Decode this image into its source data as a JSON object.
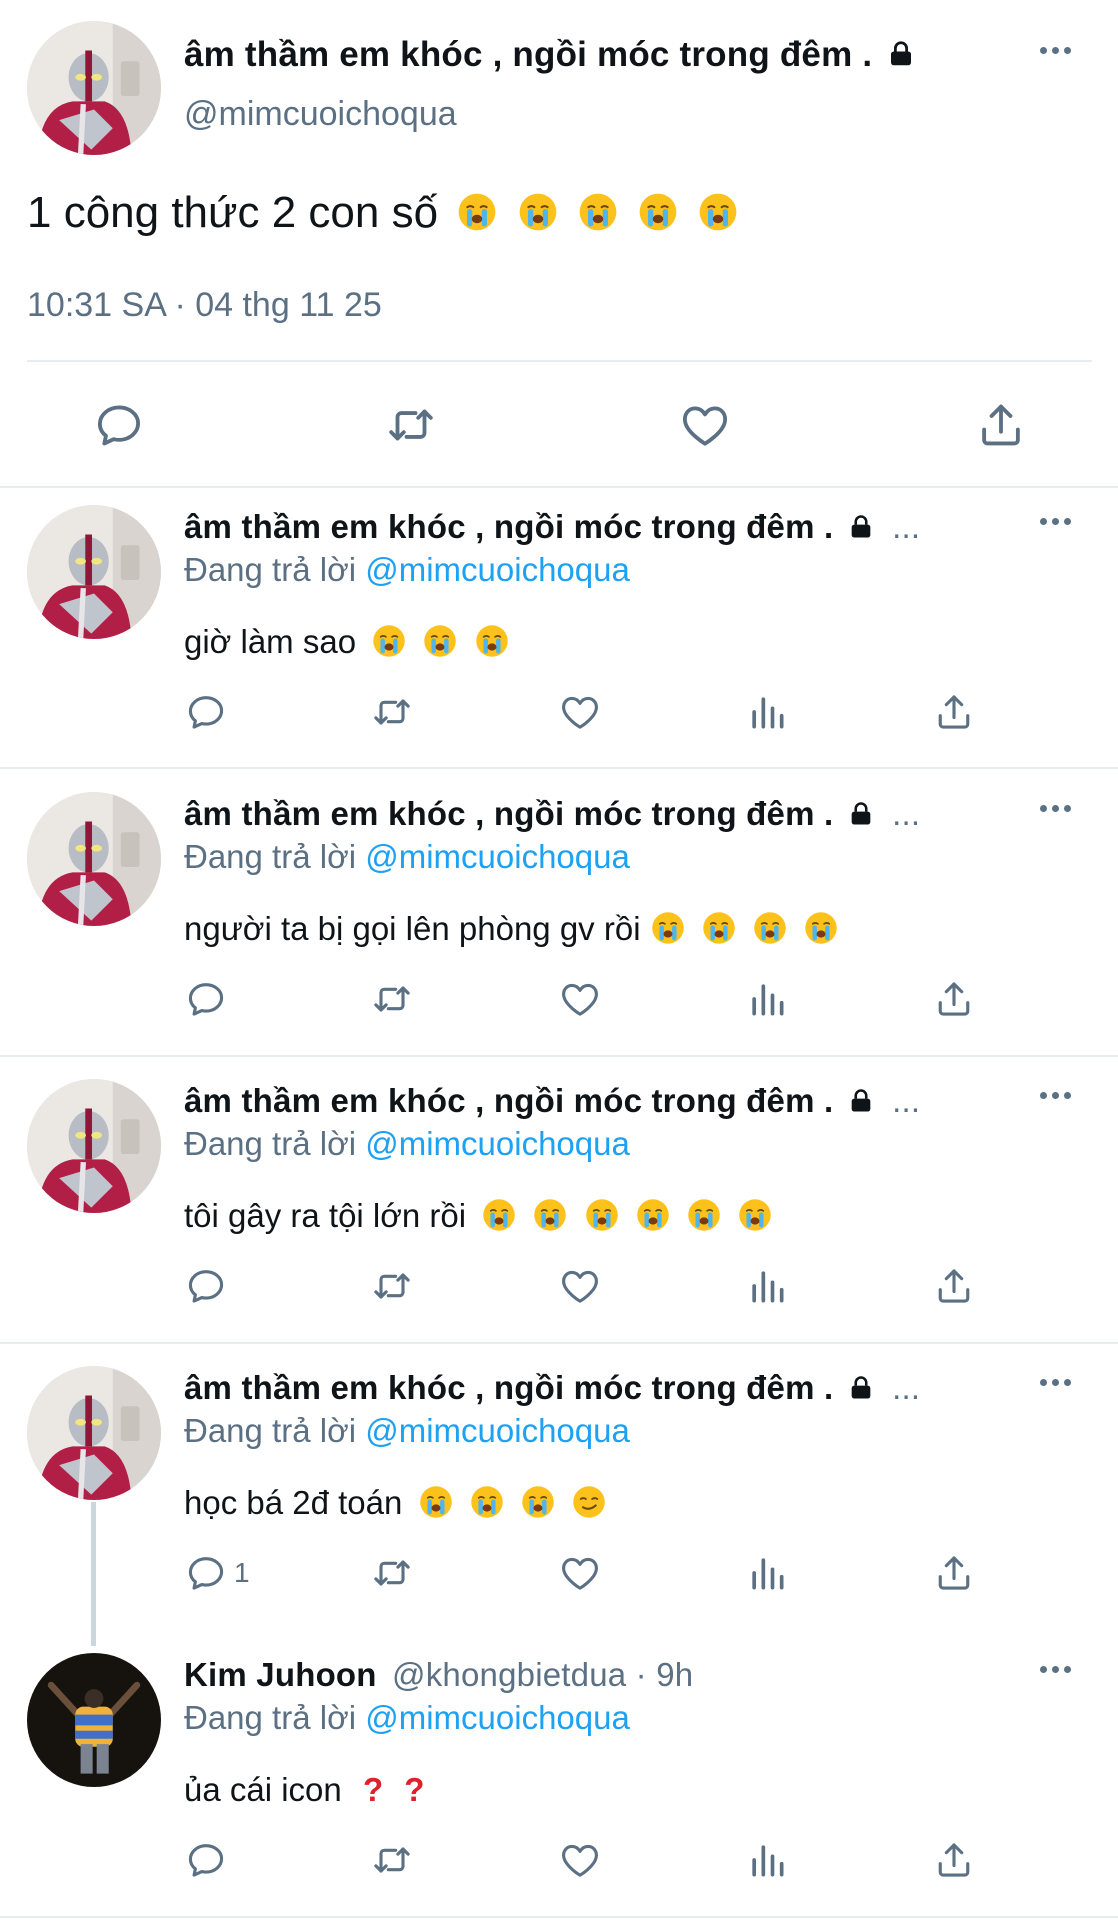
{
  "main_tweet": {
    "display_name": "âm thầm em khóc , ngồi móc trong đêm .",
    "handle": "@mimcuoichoqua",
    "text": "1 công thức 2 con số",
    "timestamp": "10:31 SA · 04 thg 11 25",
    "actions": [
      "reply-icon",
      "retweet-icon",
      "like-icon",
      "share-icon"
    ]
  },
  "replies": [
    {
      "display_name": "âm thầm em khóc , ngồi móc trong đêm .",
      "more_indicator": "...",
      "replying_prefix": "Đang trả lời",
      "mention": "@mimcuoichoqua",
      "text": "giờ làm sao"
    },
    {
      "display_name": "âm thầm em khóc , ngồi móc trong đêm .",
      "more_indicator": "...",
      "replying_prefix": "Đang trả lời",
      "mention": "@mimcuoichoqua",
      "text": "người ta bị gọi lên phòng gv rồi"
    },
    {
      "display_name": "âm thầm em khóc , ngồi móc trong đêm .",
      "more_indicator": "...",
      "replying_prefix": "Đang trả lời",
      "mention": "@mimcuoichoqua",
      "text": "tôi gây ra tội lớn rồi"
    },
    {
      "display_name": "âm thầm em khóc , ngồi móc trong đêm .",
      "more_indicator": "...",
      "replying_prefix": "Đang trả lời",
      "mention": "@mimcuoichoqua",
      "text": "học bá 2đ toán",
      "reply_count": "1"
    },
    {
      "display_name": "Kim Juhoon",
      "handle_time": "@khongbietdua · 9h",
      "replying_prefix": "Đang trả lời",
      "mention": "@mimcuoichoqua",
      "text": "ủa cái icon"
    }
  ],
  "colors": {
    "text": "#0f1419",
    "secondary": "#5b7083",
    "link": "#1da1f2",
    "divider": "#e6ecf0"
  }
}
